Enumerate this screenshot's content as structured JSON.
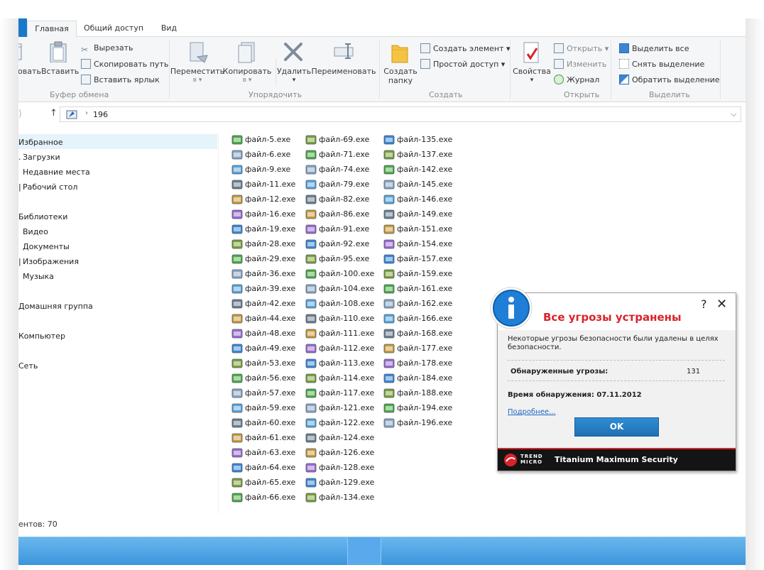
{
  "ribbon": {
    "tabs": [
      "Главная",
      "Общий доступ",
      "Вид"
    ],
    "clipboard": {
      "copy_partial": "ровать",
      "paste": "Вставить",
      "cut": "Вырезать",
      "copy_path": "Скопировать путь",
      "paste_shortcut": "Вставить ярлык",
      "group": "Буфер обмена"
    },
    "organize": {
      "move_to": "Переместить",
      "move_to_suffix": "в ▾",
      "copy_to": "Копировать",
      "copy_to_suffix": "в ▾",
      "delete": "Удалить",
      "delete_suffix": "▾",
      "rename": "Переименовать",
      "group": "Упорядочить"
    },
    "new": {
      "new_folder_1": "Создать",
      "new_folder_2": "папку",
      "new_item": "Создать элемент ▾",
      "easy_access": "Простой доступ ▾",
      "group": "Создать"
    },
    "open": {
      "properties": "Свойства",
      "properties_suffix": "▾",
      "open": "Открыть ▾",
      "edit": "Изменить",
      "history": "Журнал",
      "group": "Открыть"
    },
    "select": {
      "select_all": "Выделить все",
      "select_none": "Снять выделение",
      "invert": "Обратить выделение",
      "group": "Выделить"
    }
  },
  "address": {
    "fwd": "⟩",
    "up": "↑",
    "sep": "›",
    "path": "196",
    "dropdown": "⌵"
  },
  "nav": {
    "favorites": "Избранное",
    "downloads": "Загрузки",
    "recent": "Недавние места",
    "desktop": "Рабочий стол",
    "libraries": "Библиотеки",
    "video": "Видео",
    "documents": "Документы",
    "pictures": "Изображения",
    "music": "Музыка",
    "homegroup": "Домашняя группа",
    "computer": "Компьютер",
    "network": "Сеть"
  },
  "files": {
    "col1": [
      "файл-5.exe",
      "файл-6.exe",
      "файл-9.exe",
      "файл-11.exe",
      "файл-12.exe",
      "файл-16.exe",
      "файл-19.exe",
      "файл-28.exe",
      "файл-29.exe",
      "файл-36.exe",
      "файл-39.exe",
      "файл-42.exe",
      "файл-44.exe",
      "файл-48.exe",
      "файл-49.exe",
      "файл-53.exe",
      "файл-56.exe",
      "файл-57.exe",
      "файл-59.exe",
      "файл-60.exe",
      "файл-61.exe",
      "файл-63.exe",
      "файл-64.exe",
      "файл-65.exe",
      "файл-66.exe"
    ],
    "col2": [
      "файл-69.exe",
      "файл-71.exe",
      "файл-74.exe",
      "файл-79.exe",
      "файл-82.exe",
      "файл-86.exe",
      "файл-91.exe",
      "файл-92.exe",
      "файл-95.exe",
      "файл-100.exe",
      "файл-104.exe",
      "файл-108.exe",
      "файл-110.exe",
      "файл-111.exe",
      "файл-112.exe",
      "файл-113.exe",
      "файл-114.exe",
      "файл-117.exe",
      "файл-121.exe",
      "файл-122.exe",
      "файл-124.exe",
      "файл-126.exe",
      "файл-128.exe",
      "файл-129.exe",
      "файл-134.exe"
    ],
    "col3": [
      "файл-135.exe",
      "файл-137.exe",
      "файл-142.exe",
      "файл-145.exe",
      "файл-146.exe",
      "файл-149.exe",
      "файл-151.exe",
      "файл-154.exe",
      "файл-157.exe",
      "файл-159.exe",
      "файл-161.exe",
      "файл-162.exe",
      "файл-166.exe",
      "файл-168.exe",
      "файл-177.exe",
      "файл-178.exe",
      "файл-184.exe",
      "файл-188.exe",
      "файл-194.exe",
      "файл-196.exe"
    ]
  },
  "status": "ентов: 70",
  "popup": {
    "title": "Все угрозы устранены",
    "help": "?",
    "close": "✕",
    "desc": "Некоторые угрозы безопасности были удалены в целях безопасности.",
    "threats_label": "Обнаруженные угрозы:",
    "threats_count": "131",
    "time": "Время обнаружения: 07.11.2012",
    "more": "Подробнее...",
    "ok": "OK",
    "tm_line1": "TREND",
    "tm_line2": "MICRO",
    "brand": "Titanium Maximum Security",
    "accent": "#d8232a"
  }
}
